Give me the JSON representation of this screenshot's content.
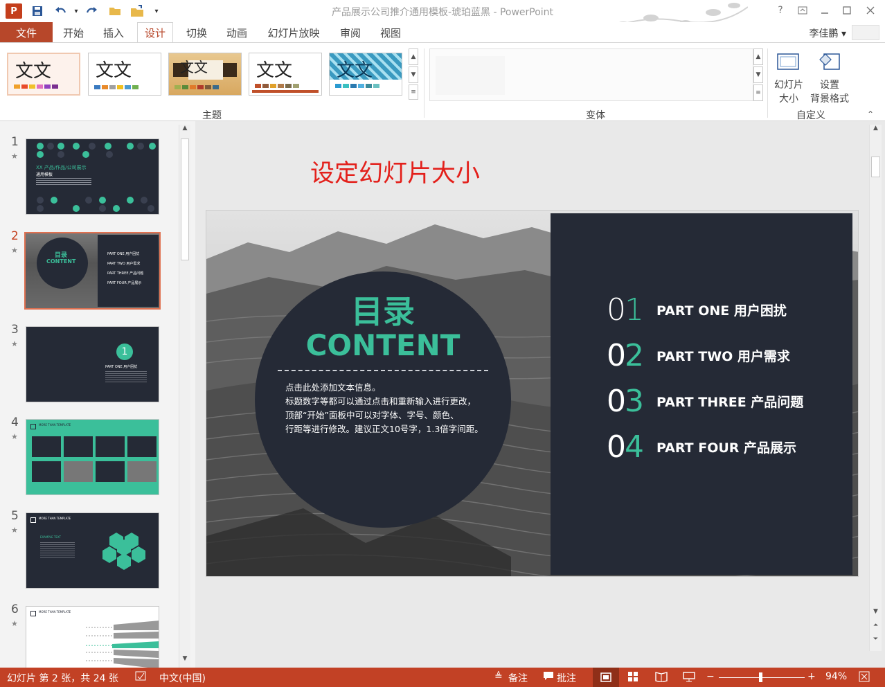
{
  "window": {
    "title": "产品展示公司推介通用模板-琥珀蓝黑 - PowerPoint",
    "app_icon": "P",
    "help": "?",
    "user": "李佳鹏 ▾"
  },
  "tabs": [
    {
      "label": "文件"
    },
    {
      "label": "开始"
    },
    {
      "label": "插入"
    },
    {
      "label": "设计"
    },
    {
      "label": "切换"
    },
    {
      "label": "动画"
    },
    {
      "label": "幻灯片放映"
    },
    {
      "label": "审阅"
    },
    {
      "label": "视图"
    }
  ],
  "ribbon": {
    "themes_label": "主题",
    "variants_label": "变体",
    "customize_label": "自定义",
    "themes": [
      {
        "text": "文文",
        "colors": [
          "#f0a02a",
          "#e94a2a",
          "#f0c02a",
          "#e070c0",
          "#9040c0",
          "#7a3090"
        ]
      },
      {
        "text": "文文",
        "colors": [
          "#3a7ac0",
          "#e88a2a",
          "#a0a0a0",
          "#f0c020",
          "#4a9ad0",
          "#70b050"
        ]
      },
      {
        "text": "文文",
        "colors": [
          "#a0b050",
          "#5a8a3a",
          "#e07a2a",
          "#b03a2a",
          "#7a5a3a",
          "#3a6a8a"
        ]
      },
      {
        "text": "文文",
        "colors": [
          "#c0502a",
          "#905a3a",
          "#e0a02a",
          "#b07a4a",
          "#7a6a4a",
          "#a0a070"
        ]
      },
      {
        "text": "文文",
        "colors": [
          "#2a9ad0",
          "#3ac0c0",
          "#2a7ab0",
          "#50b0e0",
          "#3a8a9a",
          "#6ac0c0"
        ]
      }
    ],
    "slide_size_label_1": "幻灯片",
    "slide_size_label_2": "大小",
    "format_bg_label_1": "设置",
    "format_bg_label_2": "背景格式"
  },
  "thumbnails": [
    {
      "num": "1",
      "title": "XX 产品/作品/公司展示",
      "subtitle": "通用模板"
    },
    {
      "num": "2",
      "title": "目录",
      "subtitle": "CONTENT",
      "parts": [
        "PART ONE 用户困扰",
        "PART TWO 用户需求",
        "PART THREE 产品问题",
        "PART FOUR 产品展示"
      ]
    },
    {
      "num": "3",
      "badge": "1",
      "title": "PART ONE 用户困扰"
    },
    {
      "num": "4",
      "title": "MORE THAN TEMPLATE"
    },
    {
      "num": "5",
      "title": "MORE THAN TEMPLATE",
      "label": "EXAMPLE TEXT"
    },
    {
      "num": "6",
      "title": "MORE THAN TEMPLATE"
    }
  ],
  "slide": {
    "caption": "设定幻灯片大小",
    "title_cn": "目录",
    "title_en": "CONTENT",
    "body_lines": [
      "点击此处添加文本信息。",
      "标题数字等都可以通过点击和重新输入进行更改，",
      "顶部“开始”面板中可以对字体、字号、颜色、",
      "行距等进行修改。建议正文10号字，1.3倍字间距。"
    ],
    "items": [
      {
        "num": "01",
        "text": "PART ONE  用户困扰"
      },
      {
        "num": "02",
        "text": "PART TWO  用户需求"
      },
      {
        "num": "03",
        "text": "PART THREE  产品问题"
      },
      {
        "num": "04",
        "text": "PART FOUR 产品展示"
      }
    ]
  },
  "status": {
    "slide_info": "幻灯片 第 2 张，共 24 张",
    "language": "中文(中国)",
    "notes": "备注",
    "comments": "批注",
    "zoom": "94%",
    "zoom_value": 0.47
  },
  "colors": {
    "accent": "#b7472a",
    "status_bg": "#c24125",
    "teal": "#3bbf9a",
    "slide_dark": "#252a36"
  }
}
